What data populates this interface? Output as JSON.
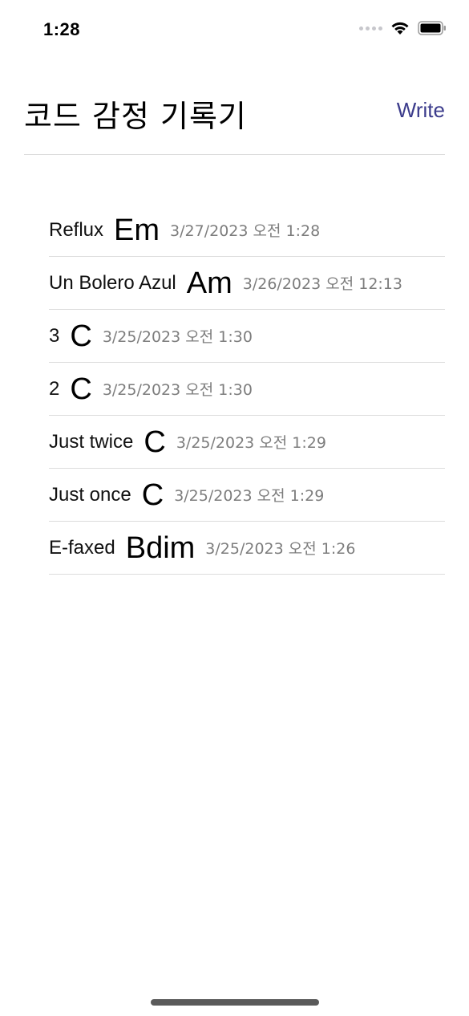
{
  "status_bar": {
    "time": "1:28"
  },
  "header": {
    "title": "코드 감정 기록기",
    "write_label": "Write"
  },
  "records": [
    {
      "title": "Reflux",
      "chord": "Em",
      "date": "3/27/2023 오전 1:28"
    },
    {
      "title": "Un Bolero Azul",
      "chord": "Am",
      "date": "3/26/2023 오전 12:13"
    },
    {
      "title": "3",
      "chord": "C",
      "date": "3/25/2023 오전 1:30"
    },
    {
      "title": "2",
      "chord": "C",
      "date": "3/25/2023 오전 1:30"
    },
    {
      "title": "Just twice",
      "chord": "C",
      "date": "3/25/2023 오전 1:29"
    },
    {
      "title": "Just once",
      "chord": "C",
      "date": "3/25/2023 오전 1:29"
    },
    {
      "title": "E-faxed",
      "chord": "Bdim",
      "date": "3/25/2023 오전 1:26"
    }
  ],
  "colors": {
    "accent": "#3c3c8c",
    "secondary_text": "#7d7d7d",
    "divider": "#dcdcdc"
  },
  "icons": {
    "signal": "cellular-signal-icon",
    "wifi": "wifi-icon",
    "battery": "battery-icon"
  }
}
